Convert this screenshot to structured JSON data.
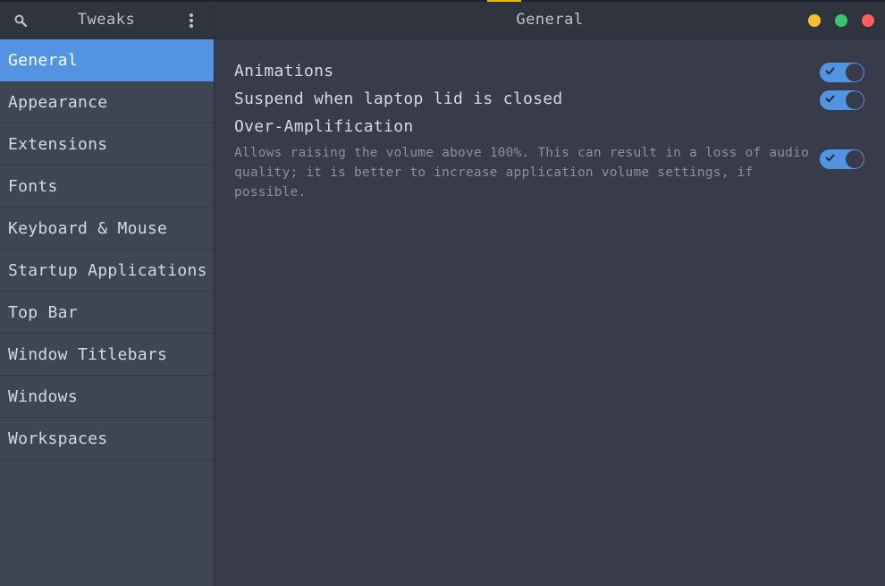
{
  "header": {
    "app_title": "Tweaks",
    "page_title": "General"
  },
  "sidebar": {
    "items": [
      {
        "label": "General",
        "selected": true
      },
      {
        "label": "Appearance",
        "selected": false
      },
      {
        "label": "Extensions",
        "selected": false
      },
      {
        "label": "Fonts",
        "selected": false
      },
      {
        "label": "Keyboard & Mouse",
        "selected": false
      },
      {
        "label": "Startup Applications",
        "selected": false
      },
      {
        "label": "Top Bar",
        "selected": false
      },
      {
        "label": "Window Titlebars",
        "selected": false
      },
      {
        "label": "Windows",
        "selected": false
      },
      {
        "label": "Workspaces",
        "selected": false
      }
    ]
  },
  "settings": [
    {
      "label": "Animations",
      "enabled": true
    },
    {
      "label": "Suspend when laptop lid is closed",
      "enabled": true
    },
    {
      "label": "Over-Amplification",
      "description": "Allows raising the volume above 100%. This can result in a loss of audio quality; it is better to increase application volume settings, if possible.",
      "enabled": true
    }
  ],
  "colors": {
    "accent": "#5294e2",
    "window_bg": "#383c4a",
    "sidebar_bg": "#404552",
    "headerbar_bg": "#2f343f",
    "minimize": "#fdbe2c",
    "maximize": "#38c76a",
    "close": "#fd5f58"
  },
  "icons": {
    "search": "search-icon",
    "menu": "vertical-dots-menu-icon",
    "check": "check-icon"
  }
}
